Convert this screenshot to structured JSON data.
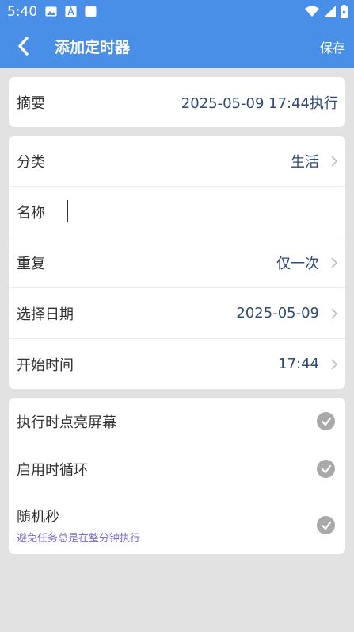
{
  "status_bar": {
    "time": "5:40",
    "icons": [
      "image-icon",
      "font-icon",
      "square-icon",
      "wifi-icon",
      "signal-icon",
      "battery-icon"
    ]
  },
  "app_bar": {
    "back_icon": "chevron-left-icon",
    "title": "添加定时器",
    "save_label": "保存"
  },
  "summary": {
    "label": "摘要",
    "value": "2025-05-09 17:44执行"
  },
  "form": {
    "category": {
      "label": "分类",
      "value": "生活"
    },
    "name": {
      "label": "名称",
      "value": ""
    },
    "repeat": {
      "label": "重复",
      "value": "仅一次"
    },
    "date": {
      "label": "选择日期",
      "value": "2025-05-09"
    },
    "start_time": {
      "label": "开始时间",
      "value": "17:44"
    }
  },
  "options": {
    "light_screen": {
      "label": "执行时点亮屏幕",
      "checked": true
    },
    "loop": {
      "label": "启用时循环",
      "checked": true
    },
    "random_seconds": {
      "label": "随机秒",
      "sub": "避免任务总是在整分钟执行",
      "checked": true
    }
  },
  "colors": {
    "primary": "#4a8fe7",
    "background": "#e2e2e2",
    "value_text": "#2e4a7a",
    "hint_text": "#7a6ccc",
    "check_bg": "#a9a9a9"
  }
}
